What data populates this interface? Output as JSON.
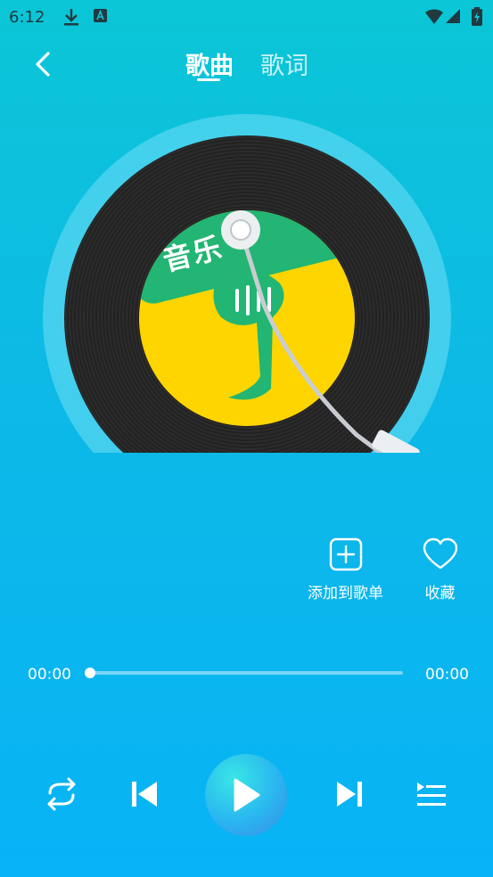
{
  "status_bar": {
    "time": "6:12"
  },
  "header": {
    "tabs": [
      {
        "label": "歌曲",
        "active": true
      },
      {
        "label": "歌词",
        "active": false
      }
    ]
  },
  "album": {
    "label_text": "音乐"
  },
  "actions": {
    "add_to_playlist": "添加到歌单",
    "favorite": "收藏"
  },
  "progress": {
    "current": "00:00",
    "total": "00:00",
    "fraction": 0.0
  },
  "colors": {
    "bg_top": "#0bc6d6",
    "bg_bottom": "#08b3f6",
    "label_yellow": "#ffd500",
    "label_green": "#22b573"
  }
}
